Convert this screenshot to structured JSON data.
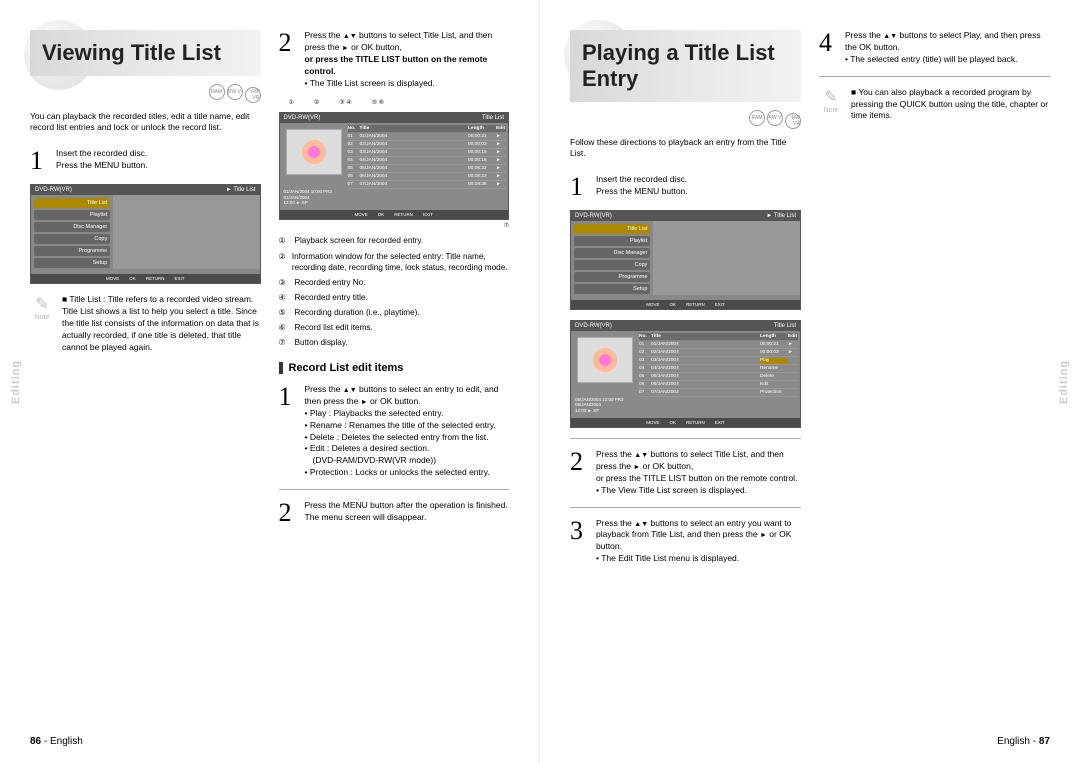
{
  "left": {
    "title": "Viewing Title List",
    "intro": "You can playback the recorded titles, edit a title name, edit record list entries and lock or unlock the record list.",
    "step1": {
      "a": "Insert the recorded disc.",
      "b": "Press the MENU button."
    },
    "menu": {
      "hdr_left": "DVD-RW(VR)",
      "hdr_right": "Title List",
      "items": [
        "Title List",
        "Playlist",
        "Disc Manager",
        "Copy",
        "Programme",
        "Setup"
      ],
      "footer": [
        "MOVE",
        "OK",
        "RETURN",
        "EXIT"
      ]
    },
    "note_title": "Title List :",
    "note_body": "Title refers to a recorded video stream. Title List shows a list to help you select a title. Since the title list consists of the information on data that is actually recorded, if one title is deleted, that title cannot be played again.",
    "step2": {
      "a_pre": "Press the ",
      "a_mid": " buttons to select Title List, and then press the ",
      "a_post": " or OK button,",
      "b": "or press the TITLE LIST button on the remote control.",
      "c": "The Title List screen is displayed."
    },
    "callouts": [
      "①",
      "②",
      "③ ④",
      "⑤  ⑥"
    ],
    "callout_side": "⑦",
    "titlelistScreen": {
      "hdr_left": "DVD-RW(VR)",
      "hdr_right": "Title List",
      "tbl_hdr": {
        "no": "No.",
        "title": "Title",
        "len": "Length",
        "edit": "Edit"
      },
      "rows": [
        {
          "no": "01",
          "title": "01/JAN/2004",
          "len": "00:00:21"
        },
        {
          "no": "02",
          "title": "02/JAN/2004",
          "len": "00:00:03"
        },
        {
          "no": "03",
          "title": "03/JAN/2004",
          "len": "00:00:15"
        },
        {
          "no": "04",
          "title": "04/JAN/2004",
          "len": "00:00:16"
        },
        {
          "no": "05",
          "title": "05/JAN/2004",
          "len": "00:06:32"
        },
        {
          "no": "06",
          "title": "06/JAN/2004",
          "len": "00:08:22"
        },
        {
          "no": "07",
          "title": "07/JAN/2004",
          "len": "00:09:36"
        }
      ],
      "info": [
        "01/JAN/2004 10:00 PR2",
        "01/JAN/2004",
        "12:00            ► SP"
      ],
      "footer": [
        "MOVE",
        "OK",
        "RETURN",
        "EXIT"
      ]
    },
    "legend": [
      {
        "n": "①",
        "t": "Playback screen for recorded entry."
      },
      {
        "n": "②",
        "t": "Information window for the selected entry: Title name, recording date, recording time, lock status, recording mode."
      },
      {
        "n": "③",
        "t": "Recorded entry No."
      },
      {
        "n": "④",
        "t": "Recorded entry title."
      },
      {
        "n": "⑤",
        "t": "Recording duration (i.e., playtime)."
      },
      {
        "n": "⑥",
        "t": "Record list edit items."
      },
      {
        "n": "⑦",
        "t": "Button display."
      }
    ],
    "subhead": "Record List edit items",
    "rstep1": {
      "a_pre": "Press the ",
      "a_mid": " buttons to select an entry to edit, and then press the ",
      "a_post": " or OK button.",
      "b1": "Play : Playbacks the selected entry.",
      "b2": "Rename : Renames the title of the selected entry.",
      "b3": "Delete : Deletes the selected entry from the list.",
      "b4": "Edit : Deletes a desired section.",
      "b4sub": "(DVD-RAM/DVD-RW(VR mode))",
      "b5": "Protection : Locks or unlocks the selected entry."
    },
    "rstep2": "Press the MENU button after the operation is finished. The menu screen will disappear."
  },
  "right": {
    "title": "Playing a Title List Entry",
    "intro": "Follow these directions to playback an entry from the Title List.",
    "step1": {
      "a": "Insert the recorded disc.",
      "b": "Press the MENU button."
    },
    "menu": {
      "hdr_left": "DVD-RW(VR)",
      "hdr_right": "Title List",
      "items": [
        "Title List",
        "Playlist",
        "Disc Manager",
        "Copy",
        "Programme",
        "Setup"
      ],
      "footer": [
        "MOVE",
        "OK",
        "RETURN",
        "EXIT"
      ]
    },
    "editScreen": {
      "hdr_left": "DVD-RW(VR)",
      "hdr_right": "Title List",
      "tbl_hdr": {
        "no": "No.",
        "title": "Title",
        "len": "Length",
        "edit": "Edit"
      },
      "rows": [
        {
          "no": "01",
          "title": "01/JAN/2004",
          "len": "00:00:21"
        },
        {
          "no": "02",
          "title": "02/JAN/2004",
          "len": "00:00:03"
        },
        {
          "no": "03",
          "title": "03/JAN/2004",
          "len": "Play"
        },
        {
          "no": "04",
          "title": "04/JAN/2004",
          "len": "Rename"
        },
        {
          "no": "05",
          "title": "05/JAN/2004",
          "len": "Delete"
        },
        {
          "no": "06",
          "title": "06/JAN/2004",
          "len": "Edit"
        },
        {
          "no": "07",
          "title": "07/JAN/2004",
          "len": "Protection"
        }
      ],
      "info": [
        "05/JAN/2004 12:00 PR3",
        "05/JAN/2004",
        "12:00            ► SP"
      ],
      "footer": [
        "MOVE",
        "OK",
        "RETURN",
        "EXIT"
      ]
    },
    "step2": {
      "a_pre": "Press the ",
      "a_mid": " buttons to select Title List, and then press the ",
      "a_post": " or OK button,",
      "b": "or press the TITLE LIST button on the remote control.",
      "c": "The View Title List screen is displayed."
    },
    "step3": {
      "a_pre": "Press the ",
      "a_mid": " buttons to select an entry you want to playback from Title List, and then press the ",
      "a_post": " or OK button.",
      "b": "The Edit Title List menu is displayed."
    },
    "step4": {
      "a_pre": "Press the ",
      "a_mid": " buttons to select Play, and then press the OK button.",
      "b": "The selected entry (title) will be played back."
    },
    "note": "You can also playback a recorded program by pressing the QUICK button using the title, chapter or time items."
  },
  "side_tab": "Editing",
  "footer_left": {
    "pn": "86",
    "lang": "English"
  },
  "footer_right": {
    "lang": "English",
    "pn": "87"
  }
}
